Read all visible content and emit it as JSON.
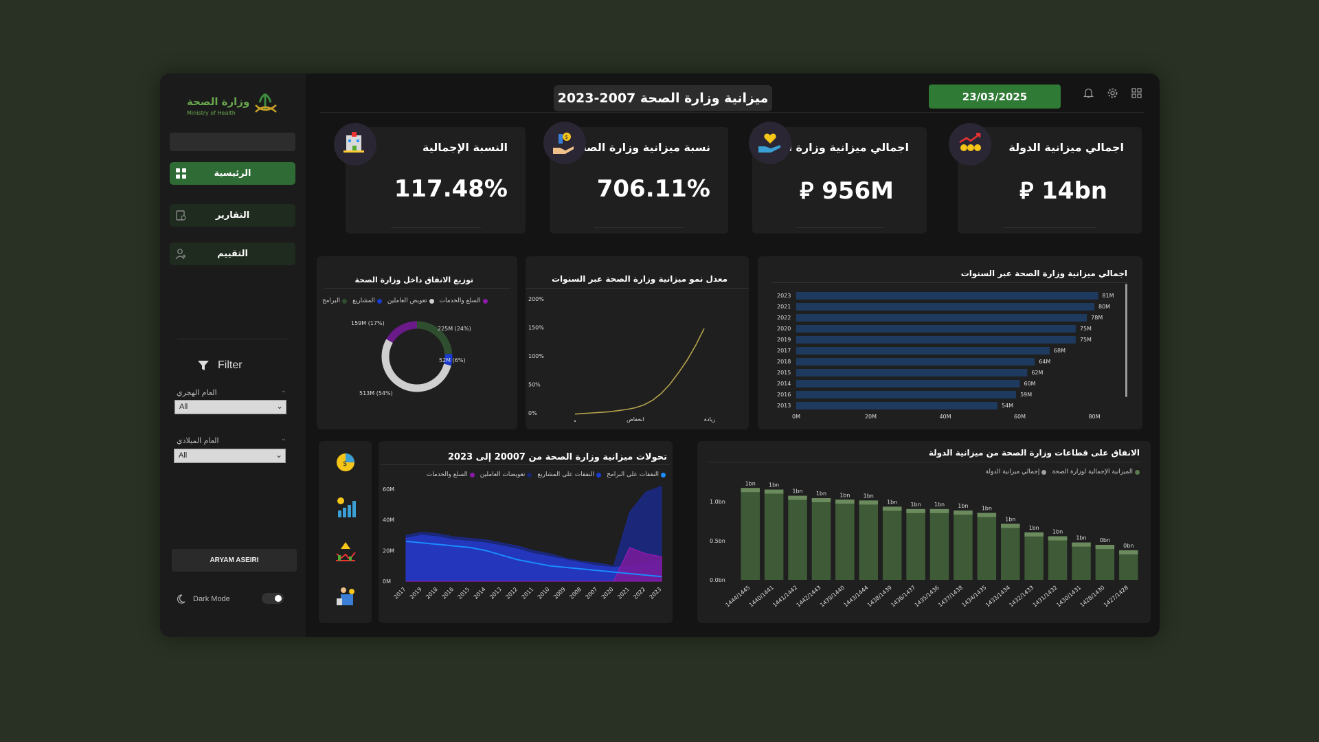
{
  "sidebar": {
    "logo_text_ar": "وزارة الصحة",
    "logo_text_en": "Ministry of Health",
    "nav": [
      {
        "label": "الرئيسية",
        "icon": "grid-icon"
      },
      {
        "label": "التقارير",
        "icon": "report-icon"
      },
      {
        "label": "التقييم",
        "icon": "user-rating-icon"
      }
    ],
    "filter_title": "Filter",
    "filters": [
      {
        "label": "العام الهجري",
        "value": "All"
      },
      {
        "label": "العام الميلادي",
        "value": "All"
      }
    ],
    "user": "ARYAM ASEIRI",
    "dark_mode_label": "Dark Mode",
    "dark_mode_on": true
  },
  "header": {
    "title": "ميزانية وزارة الصحة 2007-2023",
    "date": "23/03/2025"
  },
  "kpis": [
    {
      "title": "النسبة الإجمالية",
      "value": "117.48%",
      "icon": "hospital-icon"
    },
    {
      "title": "نسبة ميزانية وزارة الصحة",
      "value": "706.11%",
      "icon": "hand-coins-icon"
    },
    {
      "title": "اجمالي ميزانية وزارة الصحة",
      "value": "⃁ 956M",
      "icon": "heart-hand-icon"
    },
    {
      "title": "اجمالي ميزانية الدولة",
      "value": "⃁ 14bn",
      "icon": "growth-coins-icon"
    }
  ],
  "colors": {
    "accent": "#2f7a35",
    "bar": "#1f3a5f",
    "green_bar": "#3e5a36",
    "donut_green": "#2f4d2f",
    "donut_purple": "#6b1a8a",
    "donut_blue": "#1a3bcf",
    "donut_grey": "#cfcfcf",
    "line": "#b5a34a"
  },
  "chart_data": [
    {
      "type": "pie",
      "title": "توزيع الانفاق داخل وزارة الصحة",
      "legend": [
        "البرامج",
        "المشاريع",
        "تعويض العاملين",
        "السلع والخدمات"
      ],
      "legend_colors": [
        "#2f4d2f",
        "#1a3bcf",
        "#cfcfcf",
        "#8a1aa8"
      ],
      "slices": [
        {
          "label": "225M (24%)",
          "value": 225,
          "color": "#2f4d2f"
        },
        {
          "label": "52M (6%)",
          "value": 52,
          "color": "#1a3bcf"
        },
        {
          "label": "513M (54%)",
          "value": 513,
          "color": "#cfcfcf"
        },
        {
          "label": "159M (17%)",
          "value": 159,
          "color": "#6b1a8a"
        }
      ]
    },
    {
      "type": "line",
      "title": "معدل نمو ميزانية وزارة الصحة عبر السنوات",
      "y_ticks": [
        "200%",
        "150%",
        "100%",
        "50%",
        "0%"
      ],
      "x_labels": [
        "انخفاض",
        "زيادة"
      ],
      "ylim": [
        0,
        200
      ],
      "values": [
        -2,
        -1,
        0,
        1,
        2,
        4,
        6,
        9,
        14,
        22,
        34,
        50,
        70,
        92,
        118,
        148
      ]
    },
    {
      "type": "bar",
      "title": "اجمالي ميزانية وزارة الصحة عبر السنوات",
      "categories": [
        "2023",
        "2021",
        "2022",
        "2020",
        "2019",
        "2017",
        "2018",
        "2015",
        "2014",
        "2016",
        "2013"
      ],
      "values": [
        81,
        80,
        78,
        75,
        75,
        68,
        64,
        62,
        60,
        59,
        54
      ],
      "labels": [
        "81M",
        "80M",
        "78M",
        "75M",
        "75M",
        "68M",
        "64M",
        "62M",
        "60M",
        "59M",
        "54M"
      ],
      "x_ticks": [
        "0M",
        "20M",
        "40M",
        "60M",
        "80M"
      ],
      "xlim": [
        0,
        80
      ]
    },
    {
      "type": "area",
      "title": "تحولات ميزانية وزارة الصحة من 20007 إلى 2023",
      "legend": [
        "النفقات على البرامج",
        "النفقات على المشاريع",
        "تعويضات العاملين",
        "السلع والخدمات"
      ],
      "legend_colors": [
        "#1a8cff",
        "#1a3bcf",
        "#15256e",
        "#8a1aa8"
      ],
      "categories": [
        "2017",
        "2019",
        "2018",
        "2016",
        "2015",
        "2014",
        "2013",
        "2012",
        "2011",
        "2010",
        "2009",
        "2008",
        "2007",
        "2020",
        "2021",
        "2022",
        "2023"
      ],
      "y_ticks": [
        "60M",
        "40M",
        "20M",
        "0M"
      ],
      "ylim": [
        0,
        60
      ],
      "series": [
        {
          "name": "تعويضات العاملين",
          "values": [
            30,
            32,
            31,
            29,
            28,
            27,
            25,
            23,
            20,
            18,
            15,
            13,
            12,
            10,
            45,
            58,
            62
          ]
        },
        {
          "name": "النفقات على المشاريع",
          "values": [
            28,
            30,
            29,
            27,
            26,
            25,
            23,
            21,
            18,
            16,
            14,
            12,
            10,
            9,
            10,
            12,
            14
          ]
        },
        {
          "name": "السلع والخدمات",
          "values": [
            0,
            0,
            0,
            0,
            0,
            0,
            0,
            0,
            0,
            0,
            0,
            0,
            0,
            0,
            22,
            18,
            16
          ]
        },
        {
          "name": "النفقات على البرامج",
          "values": [
            26,
            25,
            24,
            23,
            22,
            20,
            17,
            14,
            12,
            10,
            9,
            8,
            7,
            6,
            5,
            4,
            3
          ]
        }
      ]
    },
    {
      "type": "bar",
      "title": "الانفاق على قطاعات وزارة الصحة من ميزانية الدولة",
      "legend": [
        "الميزانية الإجمالية لوزارة الصحة",
        "إجمالي ميزانية الدولة"
      ],
      "legend_colors": [
        "#5b7a4f",
        "#a0a0a0"
      ],
      "categories": [
        "1444/1445",
        "1440/1441",
        "1441/1442",
        "1442/1443",
        "1439/1440",
        "1443/1444",
        "1438/1439",
        "1436/1437",
        "1435/1436",
        "1437/1438",
        "1434/1435",
        "1433/1434",
        "1432/1433",
        "1431/1432",
        "1430/1431",
        "1428/1430",
        "1427/1428"
      ],
      "values": [
        1.18,
        1.16,
        1.08,
        1.05,
        1.03,
        1.02,
        0.94,
        0.91,
        0.91,
        0.89,
        0.86,
        0.72,
        0.61,
        0.56,
        0.48,
        0.45,
        0.38
      ],
      "labels": [
        "1bn",
        "1bn",
        "1bn",
        "1bn",
        "1bn",
        "1bn",
        "1bn",
        "1bn",
        "1bn",
        "1bn",
        "1bn",
        "1bn",
        "1bn",
        "1bn",
        "1bn",
        "0bn",
        "0bn"
      ],
      "y_ticks": [
        "1.0bn",
        "0.5bn",
        "0.0bn"
      ],
      "ylim": [
        0,
        1.2
      ]
    }
  ]
}
